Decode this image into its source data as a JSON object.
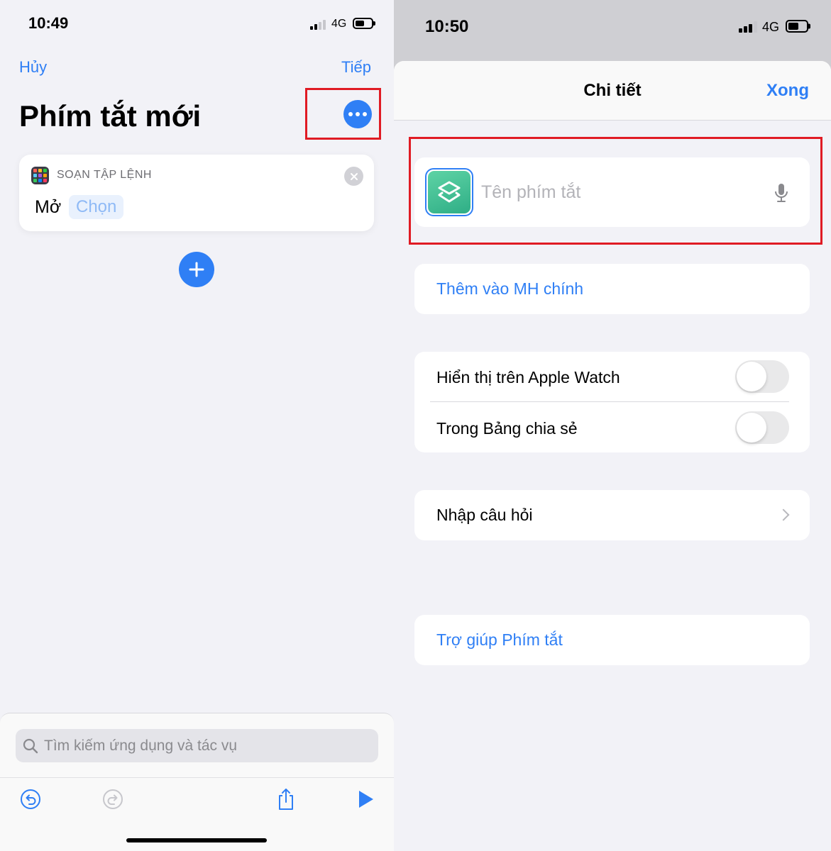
{
  "left_screen": {
    "status": {
      "time": "10:49",
      "network": "4G"
    },
    "nav": {
      "cancel_label": "Hủy",
      "next_label": "Tiếp"
    },
    "title": "Phím tắt mới",
    "action_card": {
      "category": "SOẠN TẬP LỆNH",
      "action_label": "Mở",
      "parameter_placeholder": "Chọn",
      "icon": "scripting-grid-icon"
    },
    "search": {
      "placeholder": "Tìm kiếm ứng dụng và tác vụ",
      "icon": "search-icon"
    },
    "toolbar": {
      "icons": [
        "undo-icon",
        "redo-icon",
        "share-icon",
        "play-icon"
      ]
    }
  },
  "right_screen": {
    "status": {
      "time": "10:50",
      "network": "4G"
    },
    "sheet": {
      "title": "Chi tiết",
      "done_label": "Xong"
    },
    "name_field": {
      "placeholder": "Tên phím tắt",
      "icon": "shortcuts-app-icon",
      "mic_icon": "microphone-icon"
    },
    "add_to_home": "Thêm vào MH chính",
    "toggles": [
      {
        "label": "Hiển thị trên Apple Watch",
        "on": false
      },
      {
        "label": "Trong Bảng chia sẻ",
        "on": false
      }
    ],
    "import_questions": "Nhập câu hỏi",
    "help": "Trợ giúp Phím tắt"
  },
  "colors": {
    "accent": "#2f7ff5",
    "highlight_box": "#e01b24",
    "background": "#f2f2f7"
  }
}
